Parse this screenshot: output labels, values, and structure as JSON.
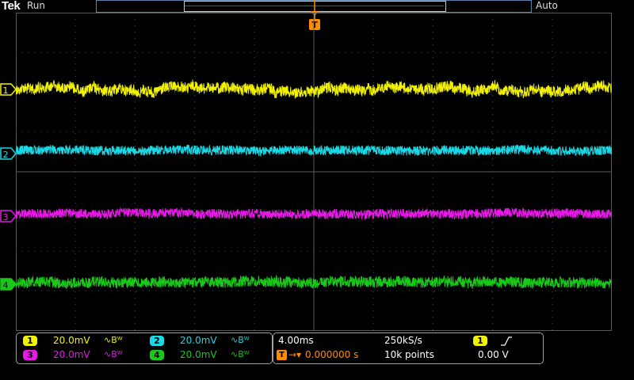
{
  "app": {
    "brand": "Tek",
    "run_state": "Run",
    "trigger_mode": "Auto"
  },
  "colors": {
    "ch1": "#f2f200",
    "ch2": "#19d9e6",
    "ch3": "#e619e6",
    "ch4": "#19c819",
    "trigger": "#ff8c00",
    "graticule": "#5a5a5a"
  },
  "trigger_marker": {
    "label": "T"
  },
  "channels": [
    {
      "number": "1",
      "scale": "20.0mV",
      "bw_icon": "bandwidth-limit-icon",
      "bw_text": "Bᵂ"
    },
    {
      "number": "2",
      "scale": "20.0mV",
      "bw_icon": "bandwidth-limit-icon",
      "bw_text": "Bᵂ"
    },
    {
      "number": "3",
      "scale": "20.0mV",
      "bw_icon": "bandwidth-limit-icon",
      "bw_text": "Bᵂ"
    },
    {
      "number": "4",
      "scale": "20.0mV",
      "bw_icon": "bandwidth-limit-icon",
      "bw_text": "Bᵂ"
    }
  ],
  "horizontal": {
    "time_per_div": "4.00ms",
    "sample_rate": "250kS/s",
    "delay_label": "T",
    "delay_value": "0.000000 s",
    "record_length": "10k points",
    "trigger_source": "1",
    "trigger_slope_icon": "rising-edge-icon",
    "trigger_level": "0.00 V"
  }
}
